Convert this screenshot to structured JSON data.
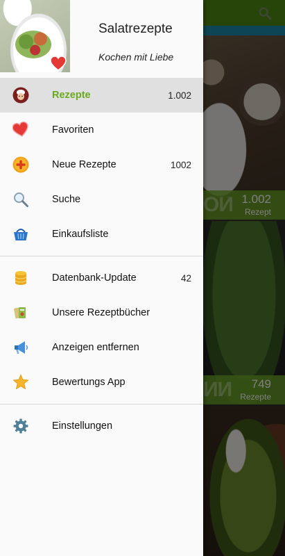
{
  "background": {
    "card1_count": "1.002",
    "card1_label": "Rezept",
    "card2_count": "749",
    "card2_label": "Rezepte",
    "accent_color": "#70aa28",
    "search_icon": "search-icon"
  },
  "drawer": {
    "title": "Salatrezepte",
    "subtitle": "Kochen mit Liebe",
    "accent_color": "#6aa81e",
    "items": [
      {
        "label": "Rezepte",
        "count": "1.002",
        "icon": "chef-icon",
        "active": true
      },
      {
        "label": "Favoriten",
        "count": "",
        "icon": "heart-icon"
      },
      {
        "label": "Neue Rezepte",
        "count": "1002",
        "icon": "plus-circle-icon"
      },
      {
        "label": "Suche",
        "count": "",
        "icon": "search-icon"
      },
      {
        "label": "Einkaufsliste",
        "count": "",
        "icon": "basket-icon"
      }
    ],
    "items2": [
      {
        "label": "Datenbank-Update",
        "count": "42",
        "icon": "database-icon"
      },
      {
        "label": "Unsere Rezeptbücher",
        "count": "",
        "icon": "books-icon"
      },
      {
        "label": "Anzeigen entfernen",
        "count": "",
        "icon": "megaphone-icon"
      },
      {
        "label": "Bewertungs App",
        "count": "",
        "icon": "star-icon"
      }
    ],
    "items3": [
      {
        "label": "Einstellungen",
        "count": "",
        "icon": "gear-icon"
      }
    ]
  }
}
